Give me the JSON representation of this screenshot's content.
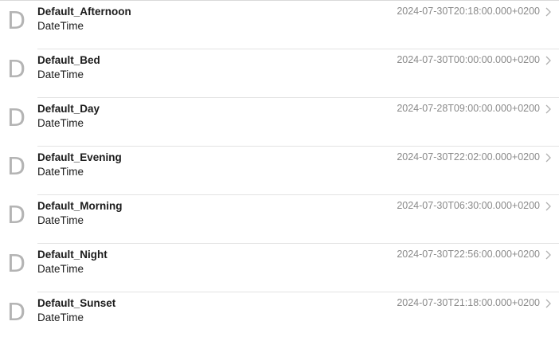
{
  "items": [
    {
      "letter": "D",
      "name": "Default_Afternoon",
      "type": "DateTime",
      "value": "2024-07-30T20:18:00.000+0200"
    },
    {
      "letter": "D",
      "name": "Default_Bed",
      "type": "DateTime",
      "value": "2024-07-30T00:00:00.000+0200"
    },
    {
      "letter": "D",
      "name": "Default_Day",
      "type": "DateTime",
      "value": "2024-07-28T09:00:00.000+0200"
    },
    {
      "letter": "D",
      "name": "Default_Evening",
      "type": "DateTime",
      "value": "2024-07-30T22:02:00.000+0200"
    },
    {
      "letter": "D",
      "name": "Default_Morning",
      "type": "DateTime",
      "value": "2024-07-30T06:30:00.000+0200"
    },
    {
      "letter": "D",
      "name": "Default_Night",
      "type": "DateTime",
      "value": "2024-07-30T22:56:00.000+0200"
    },
    {
      "letter": "D",
      "name": "Default_Sunset",
      "type": "DateTime",
      "value": "2024-07-30T21:18:00.000+0200"
    }
  ],
  "icons": {
    "row_letter": "letter-d-icon",
    "row_chevron": "chevron-right-icon"
  },
  "colors": {
    "divider": "#e3e3e3",
    "letter_icon": "#b4b4b4",
    "value_text": "#8a8a8a",
    "chevron": "#b0b0b0"
  }
}
